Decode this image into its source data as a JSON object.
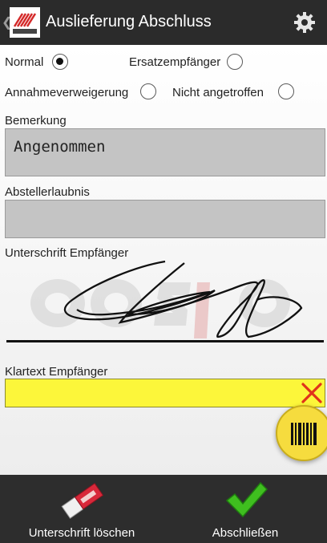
{
  "header": {
    "title": "Auslieferung Abschluss",
    "back_glyph": "❮",
    "logo_icon": "cosys-logo",
    "settings_icon": "gear-icon"
  },
  "recipient_options": [
    {
      "label": "Normal",
      "checked": true
    },
    {
      "label": "Ersatzempfänger",
      "checked": false
    },
    {
      "label": "Annahmeverweigerung",
      "checked": false
    },
    {
      "label": "Nicht angetroffen",
      "checked": false
    }
  ],
  "fields": {
    "remark_label": "Bemerkung",
    "remark_value": "Angenommen",
    "drop_permission_label": "Abstellerlaubnis",
    "drop_permission_value": "",
    "signature_label": "Unterschrift Empfänger",
    "clear_name_label": "Klartext Empfänger",
    "clear_name_value": ""
  },
  "bottom_bar": {
    "clear_signature_label": "Unterschrift löschen",
    "finish_label": "Abschließen"
  },
  "colors": {
    "appbar": "#2b2b2b",
    "input_gray": "#c4c4c4",
    "input_yellow": "#fcf63a",
    "fab_yellow": "#f6dc3e",
    "check_green": "#3fbf1f",
    "clear_red": "#e0331b"
  }
}
